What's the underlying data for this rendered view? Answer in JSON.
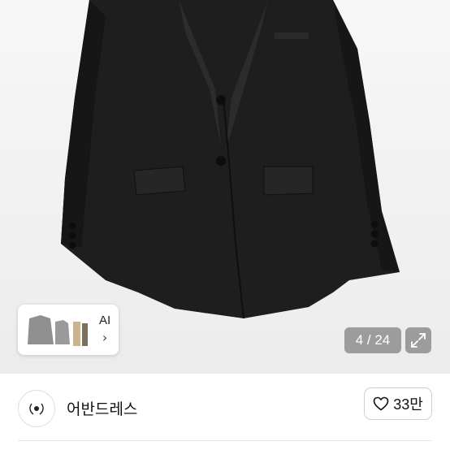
{
  "ai_chip": {
    "label": "AI",
    "chevron": "›"
  },
  "image_counter": {
    "text": "4 / 24",
    "current": 4,
    "total": 24
  },
  "seller": {
    "name": "어반드레스"
  },
  "like": {
    "count": "33만"
  },
  "icons": {
    "expand": "expand-icon",
    "heart": "heart-outline-icon",
    "chevron": "chevron-right-icon"
  }
}
